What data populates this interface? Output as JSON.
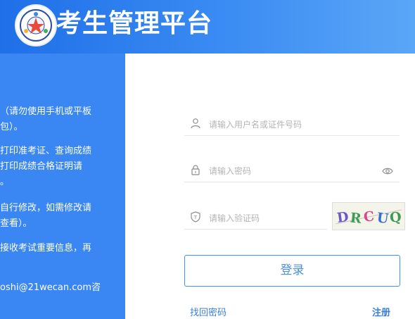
{
  "header": {
    "title": "考生管理平台"
  },
  "notes": [
    {
      "l1": "（请勿使用手机或平板",
      "l2": "包）。"
    },
    {
      "l1": "打印准考证、查询成绩",
      "l2": "打印成绩合格证明请",
      "l3": "。"
    },
    {
      "l1": "自行修改，如需修改请",
      "l2": "查看）。"
    },
    {
      "l1": "接收考试重要信息，再"
    },
    {
      "l1": "oshi@21wecan.com咨"
    }
  ],
  "form": {
    "username_placeholder": "请输入用户名或证件号码",
    "password_placeholder": "请输入密码",
    "captcha_placeholder": "请输入验证码",
    "captcha_text": "DRCUQ",
    "login_label": "登录",
    "forgot_label": "找回密码",
    "register_label": "注册"
  },
  "colors": {
    "header_blue": "#1f6fe8",
    "panel_blue": "#3a86f2",
    "link_blue": "#3a80d8"
  }
}
